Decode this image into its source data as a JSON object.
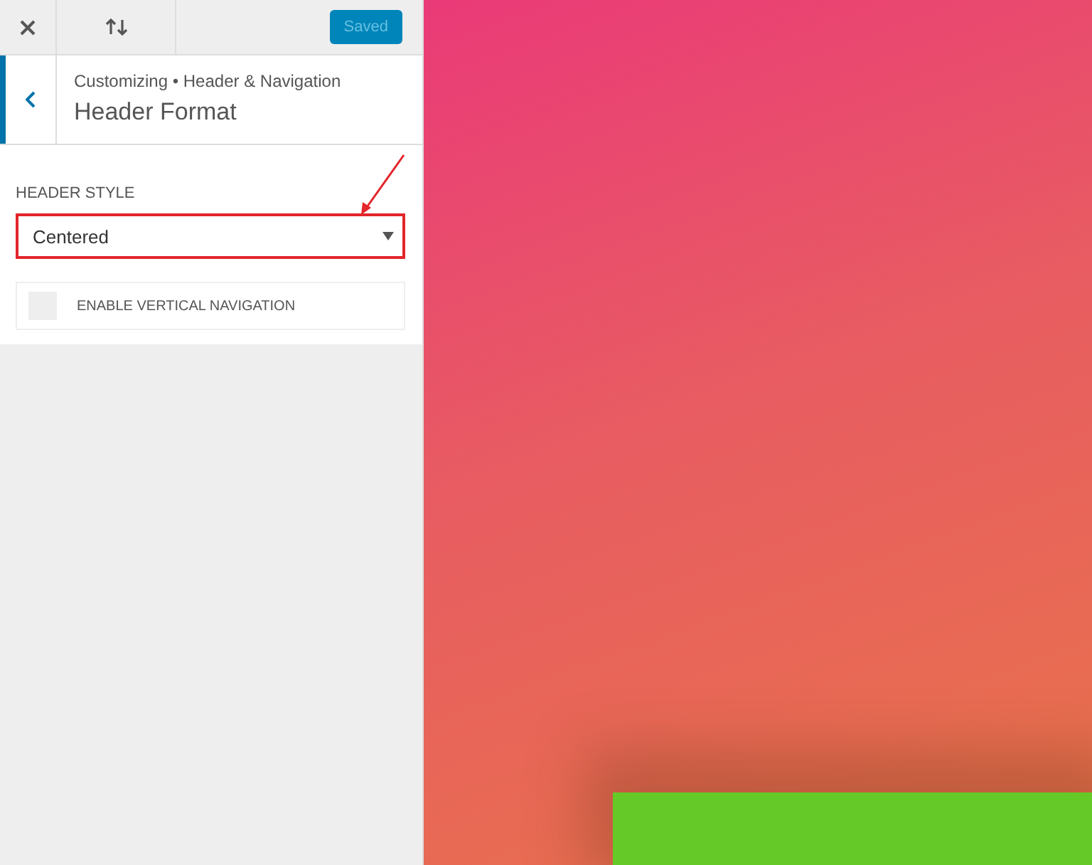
{
  "topbar": {
    "saved_button": "Saved"
  },
  "header": {
    "breadcrumb": "Customizing • Header & Navigation",
    "title": "Header Format"
  },
  "controls": [
    {
      "kind": "select",
      "label": "HEADER STYLE",
      "value": "Centered",
      "highlighted": true
    },
    {
      "kind": "checkbox",
      "label": "ENABLE VERTICAL NAVIGATION",
      "checked": false
    }
  ]
}
